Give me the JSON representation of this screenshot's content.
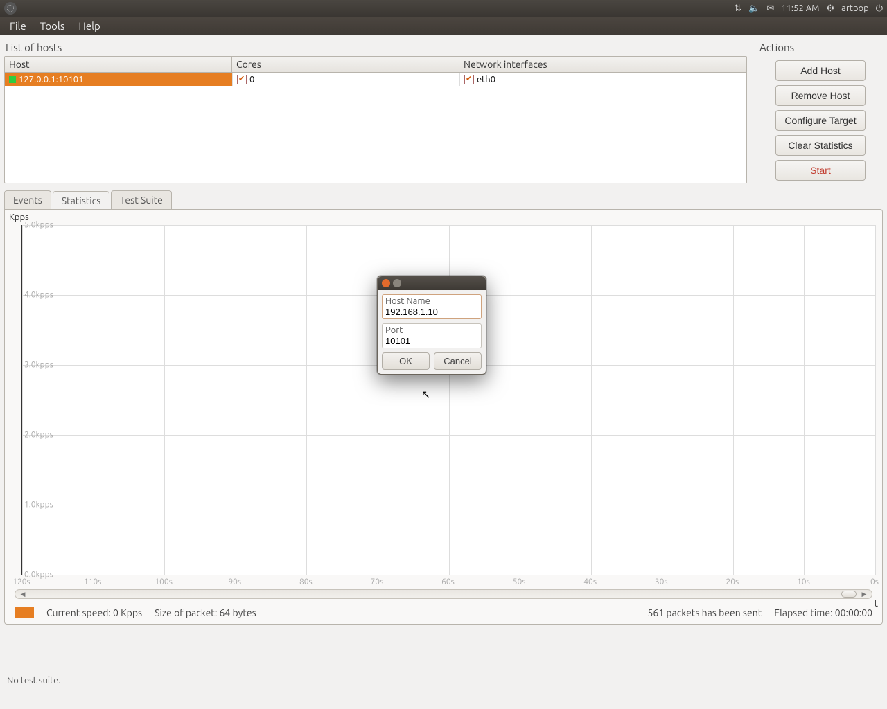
{
  "sysbar": {
    "time": "11:52 AM",
    "user": "artpop"
  },
  "menubar": [
    "File",
    "Tools",
    "Help"
  ],
  "hosts": {
    "title": "List of hosts",
    "headers": {
      "host": "Host",
      "cores": "Cores",
      "net": "Network interfaces"
    },
    "rows": [
      {
        "host": "127.0.0.1:10101",
        "cores": "0",
        "net": "eth0",
        "cores_checked": true,
        "net_checked": true
      }
    ]
  },
  "actions": {
    "title": "Actions",
    "add": "Add Host",
    "remove": "Remove Host",
    "configure": "Configure Target",
    "clear": "Clear Statistics",
    "start": "Start"
  },
  "tabs": {
    "events": "Events",
    "statistics": "Statistics",
    "testsuite": "Test Suite"
  },
  "chart_data": {
    "type": "line",
    "ylabel": "Kpps",
    "xlabel": "t",
    "y_ticks": [
      "5.0kpps",
      "4.0kpps",
      "3.0kpps",
      "2.0kpps",
      "1.0kpps",
      "0.0kpps"
    ],
    "x_ticks": [
      "120s",
      "110s",
      "100s",
      "90s",
      "80s",
      "70s",
      "60s",
      "50s",
      "40s",
      "30s",
      "20s",
      "10s",
      "0s"
    ],
    "ylim": [
      0,
      5
    ],
    "series": []
  },
  "status": {
    "speed_label": "Current speed: 0 Kpps",
    "packet_label": "Size of packet: 64 bytes",
    "sent_label": "561 packets has been sent",
    "elapsed_label": "Elapsed time: 00:00:00"
  },
  "footer": "No test suite.",
  "dialog": {
    "hostname_label": "Host Name",
    "hostname_value": "192.168.1.10",
    "port_label": "Port",
    "port_value": "10101",
    "ok": "OK",
    "cancel": "Cancel"
  }
}
